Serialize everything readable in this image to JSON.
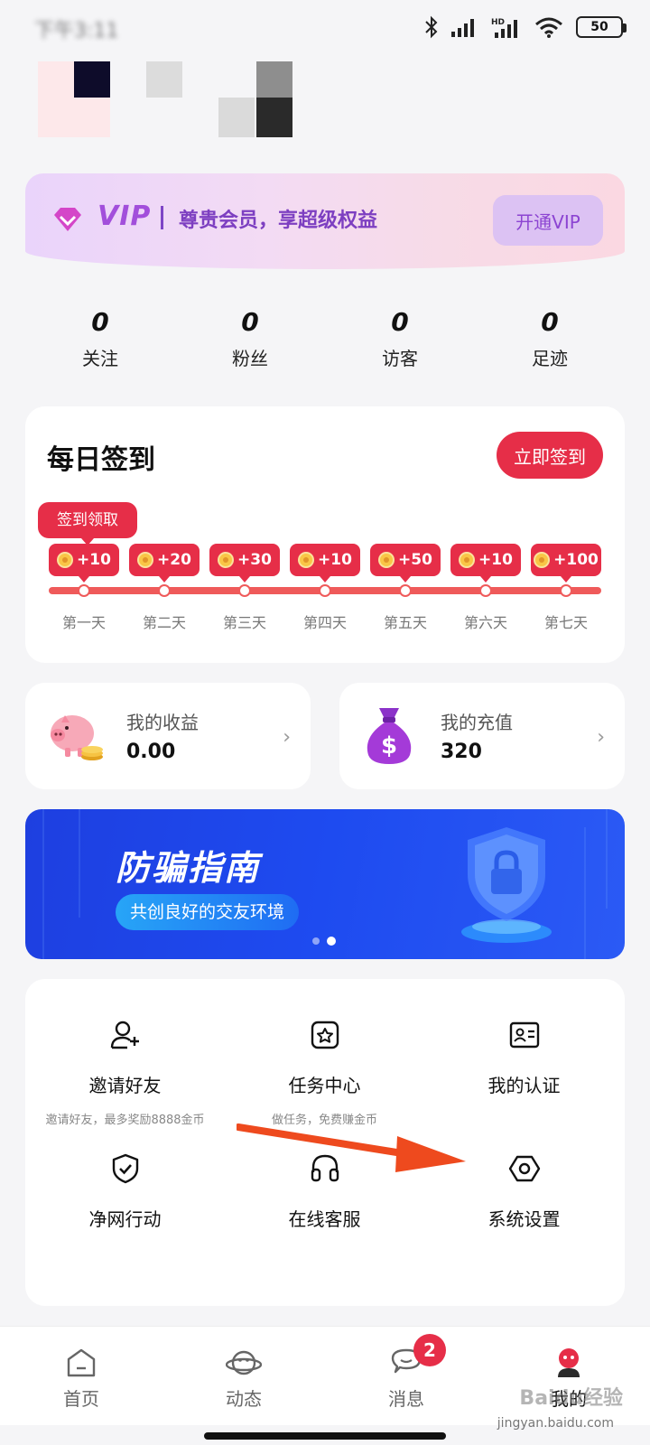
{
  "status_bar": {
    "time": "下午3:11",
    "battery": "50",
    "network": "HD"
  },
  "vip": {
    "logo": "VIP",
    "text": "尊贵会员，享超级权益",
    "button": "开通VIP"
  },
  "stats": [
    {
      "value": "0",
      "label": "关注"
    },
    {
      "value": "0",
      "label": "粉丝"
    },
    {
      "value": "0",
      "label": "访客"
    },
    {
      "value": "0",
      "label": "足迹"
    }
  ],
  "checkin": {
    "title": "每日签到",
    "button": "立即签到",
    "claim_tag": "签到领取",
    "rewards": [
      "+10",
      "+20",
      "+30",
      "+10",
      "+50",
      "+10",
      "+100"
    ],
    "days": [
      "第一天",
      "第二天",
      "第三天",
      "第四天",
      "第五天",
      "第六天",
      "第七天"
    ]
  },
  "earnings": {
    "label": "我的收益",
    "value": "0.00",
    "icon": "piggy-bank-icon"
  },
  "recharge": {
    "label": "我的充值",
    "value": "320",
    "icon": "money-bag-icon"
  },
  "banner": {
    "title": "防骗指南",
    "subtitle": "共创良好的交友环境",
    "pages": 2,
    "active_page": 2
  },
  "grid": [
    {
      "label": "邀请好友",
      "sub": "邀请好友，最多奖励8888金币",
      "icon": "add-user-icon"
    },
    {
      "label": "任务中心",
      "sub": "做任务，免费赚金币",
      "icon": "task-star-icon"
    },
    {
      "label": "我的认证",
      "sub": "",
      "icon": "id-card-icon"
    },
    {
      "label": "净网行动",
      "sub": "",
      "icon": "shield-check-icon"
    },
    {
      "label": "在线客服",
      "sub": "",
      "icon": "headset-icon"
    },
    {
      "label": "系统设置",
      "sub": "",
      "icon": "settings-hex-icon"
    }
  ],
  "tabs": [
    {
      "label": "首页",
      "icon": "home-icon"
    },
    {
      "label": "动态",
      "icon": "planet-icon"
    },
    {
      "label": "消息",
      "icon": "chat-icon",
      "badge": "2"
    },
    {
      "label": "我的",
      "icon": "profile-icon",
      "active": true
    }
  ],
  "watermark": {
    "brand": "Baidu经验",
    "url": "jingyan.baidu.com"
  },
  "colors": {
    "accent": "#e62e48",
    "vip_purple": "#8c44d2",
    "banner_blue": "#1e4bf0"
  }
}
